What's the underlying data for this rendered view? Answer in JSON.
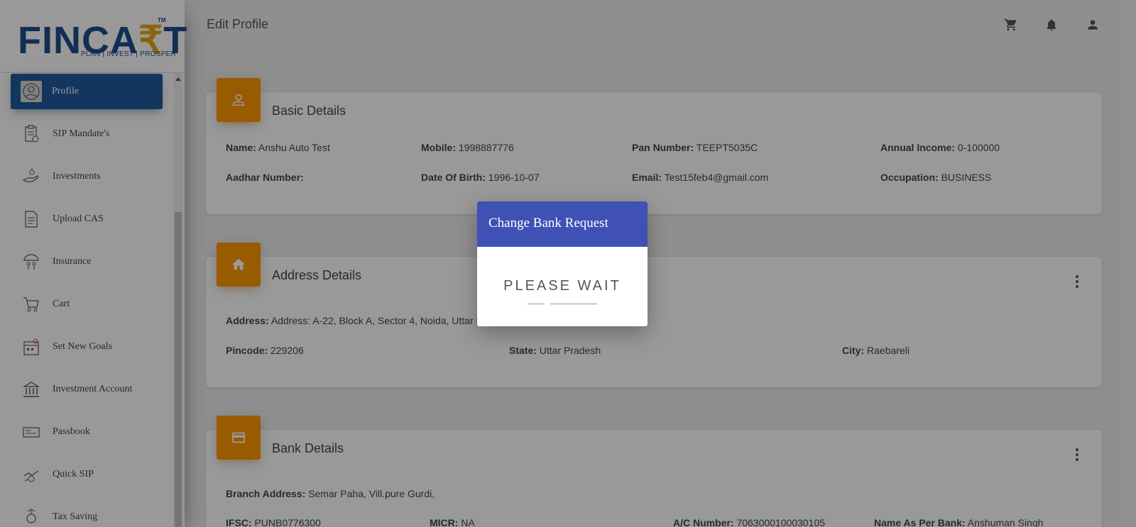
{
  "logo": {
    "text_before": "FINCA",
    "rupee": "₹",
    "text_after": "T",
    "tm": "TM",
    "tagline": "PLAN | INVEST | PROSPER"
  },
  "sidebar": {
    "items": [
      {
        "label": "Profile",
        "icon": "user-avatar-icon",
        "active": true
      },
      {
        "label": "SIP Mandate's",
        "icon": "clipboard-icon"
      },
      {
        "label": "Investments",
        "icon": "hand-money-icon"
      },
      {
        "label": "Upload CAS",
        "icon": "document-upload-icon"
      },
      {
        "label": "Insurance",
        "icon": "umbrella-family-icon"
      },
      {
        "label": "Cart",
        "icon": "cart-icon"
      },
      {
        "label": "Set New Goals",
        "icon": "goals-icon"
      },
      {
        "label": "Investment Account",
        "icon": "bank-icon"
      },
      {
        "label": "Passbook",
        "icon": "passbook-icon"
      },
      {
        "label": "Quick SIP",
        "icon": "quick-sip-icon"
      },
      {
        "label": "Tax Saving",
        "icon": "tax-saving-icon"
      }
    ]
  },
  "header": {
    "title": "Edit Profile"
  },
  "basic": {
    "title": "Basic Details",
    "name_label": "Name:",
    "name": "Anshu Auto Test",
    "mobile_label": "Mobile:",
    "mobile": "1998887776",
    "pan_label": "Pan Number:",
    "pan": "TEEPT5035C",
    "income_label": "Annual Income:",
    "income": "0-100000",
    "aadhar_label": "Aadhar Number:",
    "aadhar": "",
    "dob_label": "Date Of Birth:",
    "dob": "1996-10-07",
    "email_label": "Email:",
    "email": "Test15feb4@gmail.com",
    "occupation_label": "Occupation:",
    "occupation": "BUSINESS"
  },
  "address": {
    "title": "Address Details",
    "address_label": "Address:",
    "address": "Address: A-22, Block A, Sector 4, Noida, Uttar Pr",
    "pincode_label": "Pincode:",
    "pincode": "229206",
    "state_label": "State:",
    "state": "Uttar Pradesh",
    "city_label": "City:",
    "city": "Raebareli"
  },
  "bank": {
    "title": "Bank Details",
    "branch_label": "Branch Address:",
    "branch": "Semar Paha, Vill.pure Gurdi,",
    "ifsc_label": "IFSC:",
    "ifsc": "PUNB0776300",
    "micr_label": "MICR:",
    "micr": "NA",
    "ac_label": "A/C Number:",
    "ac": "7063000100030105",
    "name_label": "Name As Per Bank:",
    "name": "Anshuman Singh"
  },
  "modal": {
    "title": "Change Bank Request",
    "message": "PLEASE WAIT"
  },
  "colors": {
    "primary": "#1f5a9d",
    "accent": "#ff9800",
    "modal_header": "#3f51b5"
  }
}
